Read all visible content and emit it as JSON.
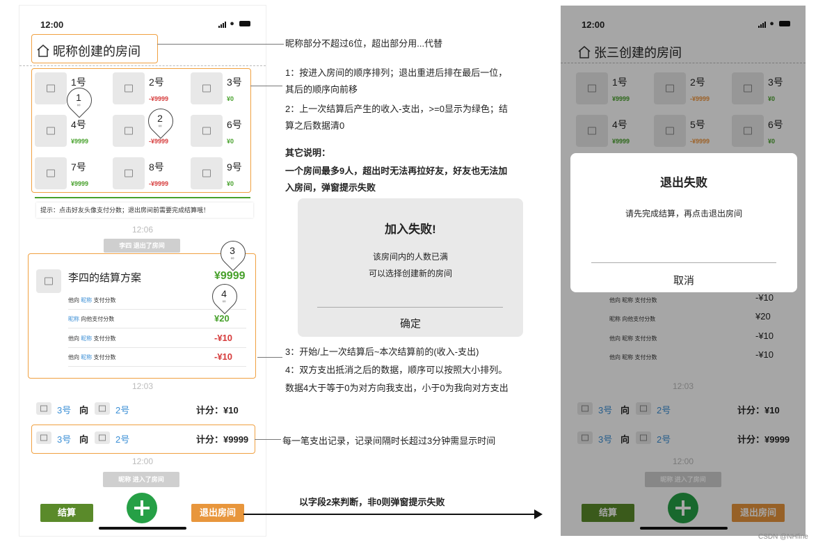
{
  "status_bar": {
    "time": "12:00"
  },
  "left_phone": {
    "room_title": "昵称创建的房间",
    "members": [
      {
        "name": "1号",
        "value": ""
      },
      {
        "name": "2号",
        "value": "-¥9999"
      },
      {
        "name": "3号",
        "value": "¥0"
      },
      {
        "name": "4号",
        "value": "¥9999"
      },
      {
        "name": "",
        "value": "-¥9999"
      },
      {
        "name": "6号",
        "value": "¥0"
      },
      {
        "name": "7号",
        "value": "¥9999"
      },
      {
        "name": "8号",
        "value": "-¥9999"
      },
      {
        "name": "9号",
        "value": "¥0"
      }
    ],
    "pins": [
      "1",
      "2",
      "3",
      "4"
    ],
    "tip": "提示：点击好友头像支付分数；退出房间前需要完成结算哦！",
    "time_1": "12:06",
    "system_msg_1": "李四 退出了房间",
    "settlement": {
      "title": "李四的结算方案",
      "total": "¥9999",
      "rows": [
        {
          "pre": "他向 ",
          "nick": "昵称",
          "post": " 支付分数",
          "amount": ""
        },
        {
          "pre": "",
          "nick": "昵称",
          "post": " 向他支付分数",
          "amount": "¥20"
        },
        {
          "pre": "他向 ",
          "nick": "昵称",
          "post": " 支付分数",
          "amount": "-¥10"
        },
        {
          "pre": "他向 ",
          "nick": "昵称",
          "post": " 支付分数",
          "amount": "-¥10"
        }
      ]
    },
    "time_2": "12:03",
    "records": [
      {
        "from": "3号",
        "dir": "向",
        "to": "2号",
        "score": "计分：¥10"
      },
      {
        "from": "3号",
        "dir": "向",
        "to": "2号",
        "score": "计分：¥9999"
      }
    ],
    "time_3": "12:00",
    "system_msg_2": "昵称 进入了房间",
    "settle_button": "结算",
    "exit_button": "退出房间"
  },
  "notes": {
    "n1": "昵称部分不超过6位，超出部分用...代替",
    "n2a": "1：按进入房间的顺序排列；退出重进后排在最后一位，",
    "n2b": "其后的顺序向前移",
    "n3a": "2：上一次结算后产生的收入-支出，>=0显示为绿色；结",
    "n3b": "算之后数据清0",
    "n4": "其它说明：",
    "n5a": "一个房间最多9人，超出时无法再拉好友，好友也无法加",
    "n5b": "入房间，弹窗提示失败",
    "n6a": "3：开始/上一次结算后~本次结算前的(收入-支出)",
    "n6b": "4：双方支出抵消之后的数据，顺序可以按照大小排列。",
    "n6c": "数据4大于等于0为对方向我支出，小于0为我向对方支出",
    "n7": "每一笔支出记录，记录间隔时长超过3分钟需显示时间",
    "n8": "以字段2来判断，非0则弹窗提示失败"
  },
  "join_dialog": {
    "title": "加入失败!",
    "line1": "该房间内的人数已满",
    "line2": "可以选择创建新的房间",
    "confirm": "确定"
  },
  "right_phone": {
    "room_title": "张三创建的房间",
    "members": [
      {
        "name": "1号",
        "value": "¥9999"
      },
      {
        "name": "2号",
        "value": "-¥9999"
      },
      {
        "name": "3号",
        "value": "¥0"
      },
      {
        "name": "4号",
        "value": "¥9999"
      },
      {
        "name": "5号",
        "value": "-¥9999"
      },
      {
        "name": "6号",
        "value": "¥0"
      }
    ],
    "rows": [
      {
        "text": "他向 昵称 支付分数",
        "amount": "-¥10"
      },
      {
        "text": "昵称 向他支付分数",
        "amount": "¥20"
      },
      {
        "text": "他向 昵称 支付分数",
        "amount": "-¥10"
      },
      {
        "text": "他向 昵称 支付分数",
        "amount": "-¥10"
      }
    ],
    "time_2": "12:03",
    "records": [
      {
        "from": "3号",
        "dir": "向",
        "to": "2号",
        "score": "计分：¥10"
      },
      {
        "from": "3号",
        "dir": "向",
        "to": "2号",
        "score": "计分：¥9999"
      }
    ],
    "time_3": "12:00",
    "system_msg_2": "昵称 进入了房间",
    "settle_button": "结算",
    "exit_button": "退出房间"
  },
  "exit_dialog": {
    "title": "退出失败",
    "message": "请先完成结算，再点击退出房间",
    "cancel": "取消"
  },
  "watermark": "CSDN @NHfine",
  "colors": {
    "green": "#46a02a",
    "red": "#d63b3b",
    "orange": "#f0963c",
    "blue": "#3b8fd6",
    "orange_button": "#e8963c",
    "olive_button": "#5a8a2a",
    "plus_green": "#26a046"
  }
}
